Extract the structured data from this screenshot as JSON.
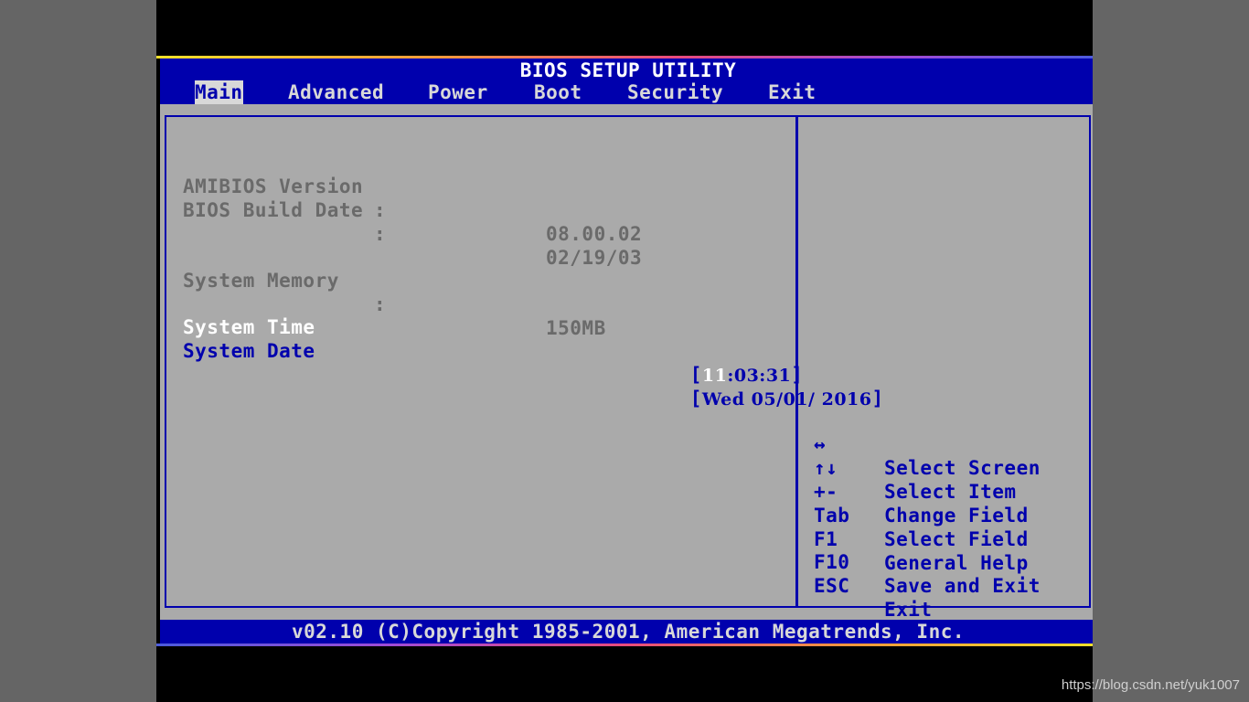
{
  "title": "BIOS SETUP UTILITY",
  "menu": {
    "items": [
      {
        "label": "Main",
        "active": true
      },
      {
        "label": "Advanced",
        "active": false
      },
      {
        "label": "Power",
        "active": false
      },
      {
        "label": "Boot",
        "active": false
      },
      {
        "label": "Security",
        "active": false
      },
      {
        "label": "Exit",
        "active": false
      }
    ]
  },
  "main": {
    "amibios": {
      "label": "AMIBIOS Version",
      "sep": ":",
      "value": "08.00.02"
    },
    "build_date": {
      "label": "BIOS Build Date",
      "sep": ":",
      "value": "02/19/03"
    },
    "memory": {
      "label": "System Memory",
      "sep": ":",
      "value": "150MB"
    },
    "time": {
      "label": "System Time",
      "open": "[",
      "close": "]",
      "hour": "11",
      "colon1": ":",
      "minute": "03",
      "colon2": ":",
      "second": "31"
    },
    "date": {
      "label": "System Date",
      "open": "[",
      "close": "]",
      "day": "Wed",
      "month": "05",
      "slash1": "/",
      "dd": "01",
      "slash2": "/",
      "year": "2016"
    }
  },
  "help": {
    "items": [
      {
        "key": "↔",
        "desc": "Select Screen"
      },
      {
        "key": "↑↓",
        "desc": "Select Item"
      },
      {
        "key": "+-",
        "desc": "Change Field"
      },
      {
        "key": "Tab",
        "desc": "Select Field"
      },
      {
        "key": "F1",
        "desc": "General Help"
      },
      {
        "key": "F10",
        "desc": "Save and Exit"
      },
      {
        "key": "ESC",
        "desc": "Exit"
      }
    ]
  },
  "footer": "v02.10 (C)Copyright 1985-2001, American Megatrends, Inc.",
  "watermark": "https://blog.csdn.net/yuk1007",
  "colors": {
    "bios_blue": "#0000ad",
    "panel_gray": "#aaaaaa",
    "menu_text": "#d8d8d8",
    "static_text": "#6a6a6a",
    "highlight": "#ffffff"
  }
}
